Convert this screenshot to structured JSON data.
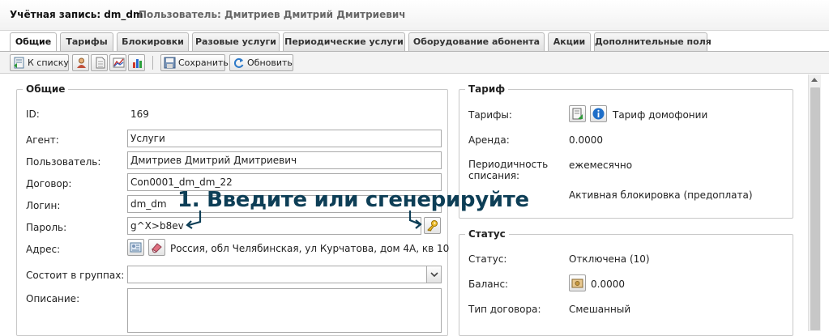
{
  "header": {
    "account": "Учётная запись: dm_dm",
    "user": "Пользователь: Дмитриев Дмитрий Дмитриевич"
  },
  "tabs": [
    {
      "label": "Общие"
    },
    {
      "label": "Тарифы"
    },
    {
      "label": "Блокировки"
    },
    {
      "label": "Разовые услуги"
    },
    {
      "label": "Периодические услуги"
    },
    {
      "label": "Оборудование абонента"
    },
    {
      "label": "Акции"
    },
    {
      "label": "Дополнительные поля"
    }
  ],
  "toolbar": {
    "back_label": "К списку",
    "save_label": "Сохранить",
    "refresh_label": "Обновить"
  },
  "general": {
    "legend": "Общие",
    "id_label": "ID:",
    "id_value": "169",
    "agent_label": "Агент:",
    "agent_value": "Услуги",
    "user_label": "Пользователь:",
    "user_value": "Дмитриев Дмитрий Дмитриевич",
    "contract_label": "Договор:",
    "contract_value": "Con0001_dm_dm_22",
    "login_label": "Логин:",
    "login_value": "dm_dm",
    "password_label": "Пароль:",
    "password_value": "g^X>b8ev",
    "address_label": "Адрес:",
    "address_value": "Россия, обл Челябинская, ул Курчатова, дом 4А, кв 10",
    "groups_label": "Состоит в группах:",
    "groups_value": "",
    "description_label": "Описание:",
    "description_value": ""
  },
  "tariff": {
    "legend": "Тариф",
    "tariffs_label": "Тарифы:",
    "tariffs_value": "Тариф домофонии",
    "rent_label": "Аренда:",
    "rent_value": "0.0000",
    "periodicity_label_1": "Периодичность",
    "periodicity_label_2": "списания:",
    "periodicity_value": "ежемесячно",
    "block_value": "Активная блокировка (предоплата)"
  },
  "status": {
    "legend": "Статус",
    "status_label": "Статус:",
    "status_value": "Отключена (10)",
    "balance_label": "Баланс:",
    "balance_value": "0.0000",
    "contract_type_label": "Тип договора:",
    "contract_type_value": "Смешанный"
  },
  "annotation": "1. Введите или сгенерируйте",
  "icons": {
    "back": "list-back-icon",
    "user": "user-icon",
    "document": "document-icon",
    "chart": "chart-icon",
    "bar_chart": "bar-chart-icon",
    "save": "save-icon",
    "refresh": "refresh-icon",
    "key": "key-icon",
    "address_book": "address-card-icon",
    "eraser": "eraser-icon",
    "tariff_edit": "tariff-edit-icon",
    "info": "info-icon",
    "balance": "balance-icon",
    "dropdown": "chevron-down-icon"
  },
  "colors": {
    "annotation": "#0d3e56",
    "border": "#c8c8c8"
  }
}
